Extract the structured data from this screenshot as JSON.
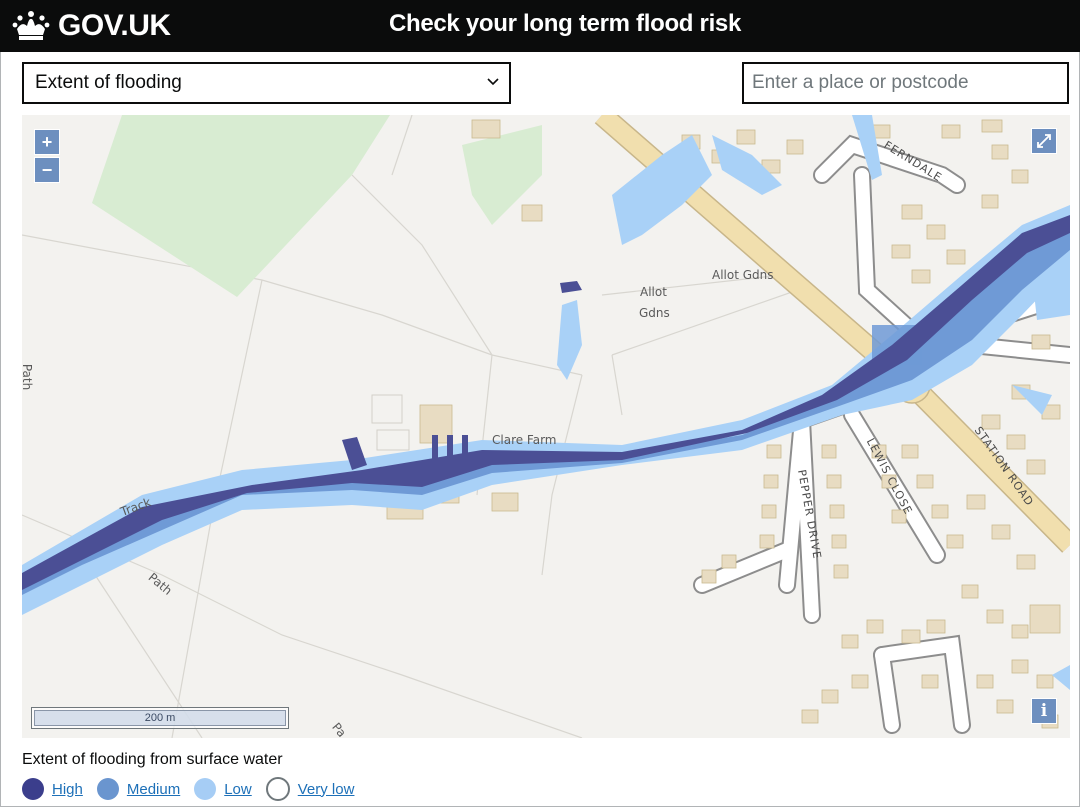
{
  "header": {
    "logo_text": "GOV.UK",
    "title": "Check your long term flood risk"
  },
  "controls": {
    "map_type_selected": "Extent of flooding",
    "search_placeholder": "Enter a place or postcode"
  },
  "map": {
    "zoom_in": "+",
    "zoom_out": "−",
    "fullscreen_icon": "expand-icon",
    "info_label": "i",
    "scale_text": "200 m",
    "labels": {
      "allot_1": "Allot",
      "allot_gdns_1": "Gdns",
      "allot_2": "Allot Gdns",
      "clare_farm": "Clare Farm",
      "track": "Track",
      "path_1": "Path",
      "path_2": "Path",
      "path_3": "Pa",
      "ferndale": "FERNDALE",
      "station_road": "STATION ROAD",
      "lewis_close": "LEWIS CLOSE",
      "pepper_drive": "PEPPER DRIVE"
    }
  },
  "legend": {
    "title": "Extent of flooding from surface water",
    "items": [
      {
        "label": "High",
        "color": "#3b3e8c"
      },
      {
        "label": "Medium",
        "color": "#6a95cf"
      },
      {
        "label": "Low",
        "color": "#a6cdf5"
      },
      {
        "label": "Very low",
        "color": "#ffffff"
      }
    ]
  },
  "colors": {
    "header_bg": "#0b0c0c",
    "flood_high": "#4b4f95",
    "flood_medium": "#6f9ad6",
    "flood_low": "#a9d1f7",
    "map_bg": "#f3f2ef",
    "building": "#e8dcc2",
    "green": "#d8ecd2",
    "road_major": "#f1dfae",
    "link": "#1d70b8"
  }
}
